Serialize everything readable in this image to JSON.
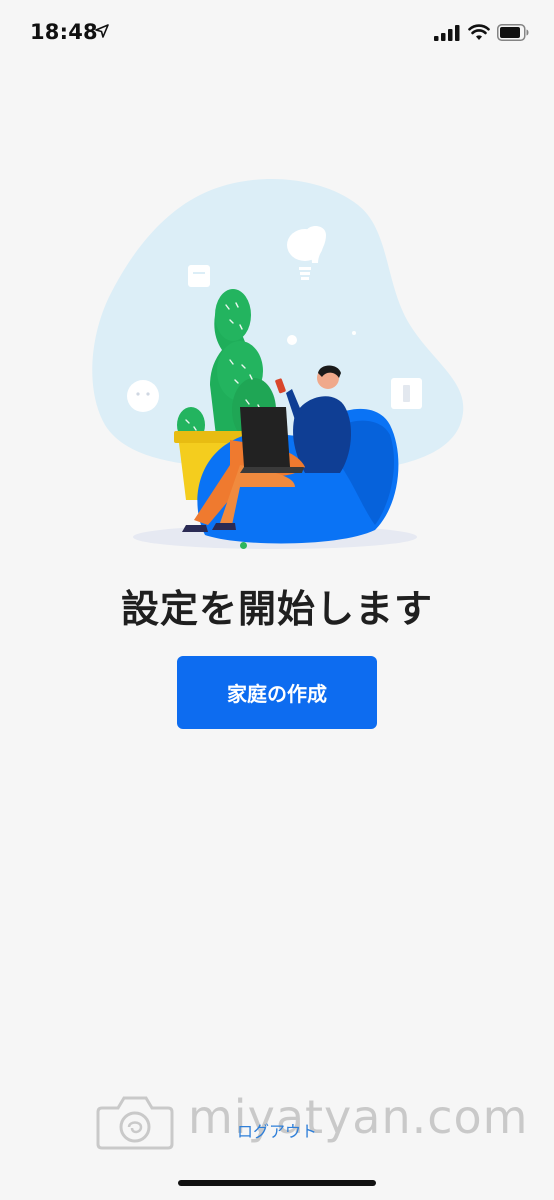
{
  "status_bar": {
    "time": "18:48",
    "icons": [
      "location-arrow-icon",
      "cellular-signal-icon",
      "wifi-icon",
      "battery-icon"
    ]
  },
  "onboarding": {
    "title": "設定を開始します",
    "primary_button_label": "家庭の作成",
    "logout_label": "ログアウト",
    "page_indicator": {
      "current": 1,
      "total": 1
    }
  },
  "watermark": {
    "text": "miyatyan.com",
    "icon": "camera-logo-icon"
  },
  "colors": {
    "accent": "#0d6cf0",
    "page_dot": "#2db55d",
    "link": "#2f7fd8",
    "background": "#f6f6f6"
  }
}
